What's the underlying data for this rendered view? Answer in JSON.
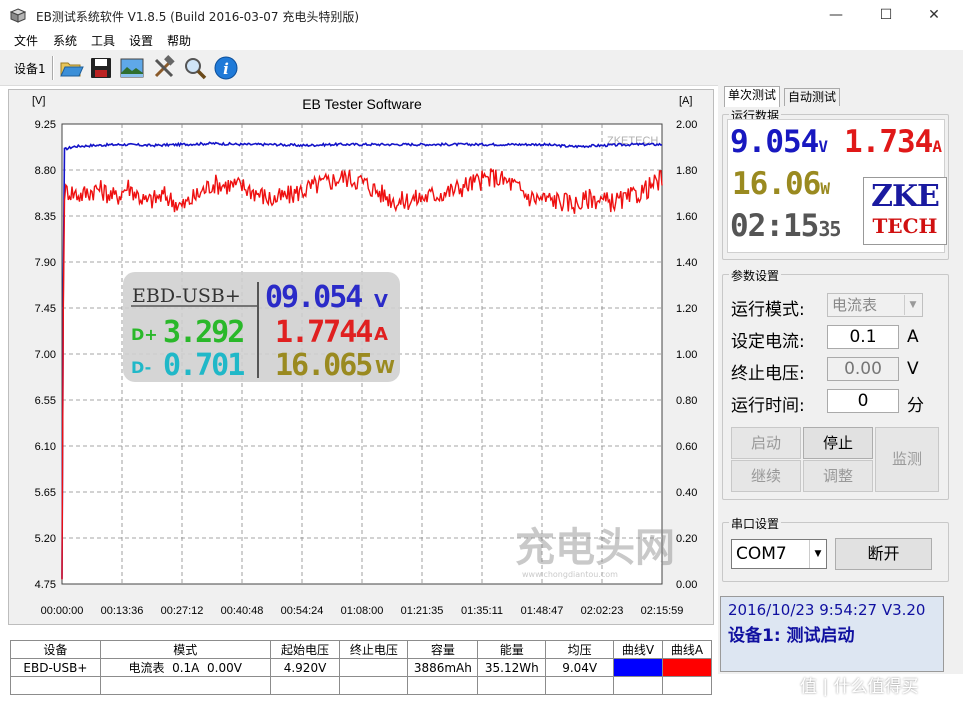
{
  "window": {
    "title": "EB测试系统软件 V1.8.5 (Build 2016-03-07 充电头特别版)",
    "minimize": "—",
    "maximize": "☐",
    "close": "✕"
  },
  "menu": [
    "文件",
    "系统",
    "工具",
    "设置",
    "帮助"
  ],
  "toolbar": {
    "device_label": "设备1",
    "buttons": [
      "open-folder-icon",
      "save-icon",
      "image-icon",
      "tools-icon",
      "search-icon",
      "info-icon"
    ]
  },
  "chart_data": {
    "type": "line",
    "title": "EB Tester Software",
    "left_unit": "[V]",
    "right_unit": "[A]",
    "watermark": "ZKETECH",
    "y_left_ticks": [
      "9.25",
      "8.80",
      "8.35",
      "7.90",
      "7.45",
      "7.00",
      "6.55",
      "6.10",
      "5.65",
      "5.20",
      "4.75"
    ],
    "y_right_ticks": [
      "2.00",
      "1.80",
      "1.60",
      "1.40",
      "1.20",
      "1.00",
      "0.80",
      "0.60",
      "0.40",
      "0.20",
      "0.00"
    ],
    "x_ticks": [
      "00:00:00",
      "00:13:36",
      "00:27:12",
      "00:40:48",
      "00:54:24",
      "01:08:00",
      "01:21:35",
      "01:35:11",
      "01:48:47",
      "02:02:23",
      "02:15:59"
    ],
    "ylim_left": [
      4.75,
      9.25
    ],
    "ylim_right": [
      0,
      2
    ],
    "grid": true,
    "series": [
      {
        "name": "曲线V",
        "axis": "left",
        "color": "#1414c8",
        "t": [
          0,
          0.003,
          0.02,
          0.05,
          0.1,
          0.15,
          0.2,
          0.25,
          0.3,
          0.35,
          0.4,
          0.45,
          0.5,
          0.55,
          0.6,
          0.65,
          0.7,
          0.75,
          0.8,
          0.85,
          0.9,
          0.95,
          1.0
        ],
        "values": [
          4.8,
          9.0,
          9.03,
          9.04,
          9.05,
          9.04,
          9.05,
          9.06,
          9.05,
          9.05,
          9.04,
          9.05,
          9.05,
          9.05,
          9.05,
          9.05,
          9.05,
          9.05,
          9.05,
          9.03,
          9.04,
          9.05,
          9.05
        ]
      },
      {
        "name": "曲线A",
        "axis": "right",
        "color": "#ee1010",
        "t": [
          0,
          0.003,
          0.01,
          0.03,
          0.06,
          0.09,
          0.11,
          0.14,
          0.17,
          0.2,
          0.25,
          0.3,
          0.35,
          0.38,
          0.42,
          0.47,
          0.5,
          0.53,
          0.56,
          0.6,
          0.65,
          0.68,
          0.72,
          0.75,
          0.78,
          0.82,
          0.86,
          0.88,
          0.91,
          0.94,
          0.97,
          1.0
        ],
        "values": [
          0.02,
          1.7,
          1.71,
          1.69,
          1.72,
          1.68,
          1.73,
          1.66,
          1.69,
          1.64,
          1.74,
          1.73,
          1.67,
          1.69,
          1.73,
          1.77,
          1.75,
          1.7,
          1.66,
          1.68,
          1.71,
          1.74,
          1.77,
          1.74,
          1.68,
          1.67,
          1.65,
          1.68,
          1.66,
          1.67,
          1.71,
          1.76
        ]
      }
    ]
  },
  "overlay": {
    "device": "EBD-USB+",
    "voltage": "09.054",
    "voltage_unit": "V",
    "dplus_label": "D+",
    "dplus": "3.292",
    "current": "1.7744",
    "current_unit": "A",
    "dminus_label": "D-",
    "dminus": "0.701",
    "power": "16.065",
    "power_unit": "W"
  },
  "site_watermark": {
    "logo_text": "充电头网",
    "url": "www.chongdiantou.com"
  },
  "table": {
    "headers": [
      "设备",
      "模式",
      "起始电压",
      "终止电压",
      "容量",
      "能量",
      "均压",
      "曲线V",
      "曲线A"
    ],
    "row": [
      "EBD-USB+",
      "电流表  0.1A  0.00V",
      "4.920V",
      "",
      "3886mAh",
      "35.12Wh",
      "9.04V"
    ],
    "curve_v_color": "#0000ff",
    "curve_a_color": "#ff0000"
  },
  "right": {
    "tabs": [
      "单次测试",
      "自动测试"
    ],
    "realtime_title": "运行数据",
    "rt_voltage": "9.054",
    "rt_voltage_unit": "V",
    "rt_current": "1.734",
    "rt_current_unit": "A",
    "rt_power": "16.06",
    "rt_power_unit": "W",
    "rt_time": "02:15",
    "rt_time_sec": "35",
    "logo_line1": "ZKE",
    "logo_line2": "TECH",
    "params_title": "参数设置",
    "mode_label": "运行模式:",
    "mode_value": "电流表",
    "set_current_label": "设定电流:",
    "set_current_value": "0.1",
    "set_current_unit": "A",
    "cutoff_voltage_label": "终止电压:",
    "cutoff_voltage_value": "0.00",
    "cutoff_voltage_unit": "V",
    "run_time_label": "运行时间:",
    "run_time_value": "0",
    "run_time_unit": "分",
    "btn_start": "启动",
    "btn_stop": "停止",
    "btn_continue": "继续",
    "btn_adjust": "调整",
    "btn_monitor": "监测",
    "serial_title": "串口设置",
    "com_value": "COM7",
    "btn_disconnect": "断开",
    "status_line1": "2016/10/23 9:54:27  V3.20",
    "status_line2": "设备1: 测试启动"
  },
  "corner_watermark": "值 | 什么值得买"
}
